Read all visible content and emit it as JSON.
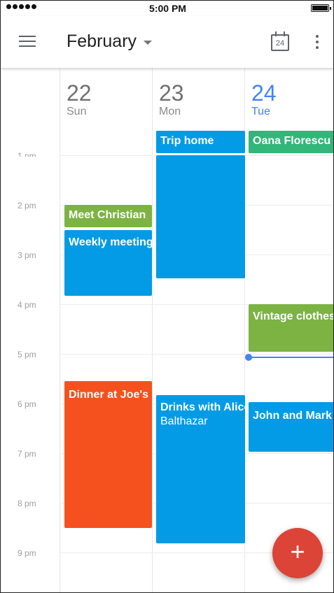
{
  "status_bar": {
    "time": "5:00 PM"
  },
  "app_bar": {
    "month": "February",
    "today_number": "24"
  },
  "days": [
    {
      "number": "22",
      "weekday": "Sun"
    },
    {
      "number": "23",
      "weekday": "Mon"
    },
    {
      "number": "24",
      "weekday": "Tue"
    }
  ],
  "hours": [
    "1 pm",
    "2 pm",
    "3 pm",
    "4 pm",
    "5 pm",
    "6 pm",
    "7 pm",
    "8 pm",
    "9 pm"
  ],
  "events": {
    "meet_christian": "Meet Christian",
    "weekly_meeting": "Weekly meeting",
    "dinner_joes": "Dinner at Joe's",
    "trip_home": "Trip home",
    "drinks": "Drinks with Alice",
    "drinks_location": "Balthazar",
    "oana": "Oana Florescu",
    "vintage": "Vintage clothes",
    "john_mark": "John and Mark"
  },
  "colors": {
    "blue": "#039be5",
    "green": "#7cb342",
    "teal": "#33b679",
    "orange": "#f4511e",
    "today_accent": "#4285f4",
    "fab_red": "#db4437"
  },
  "fab": {
    "label": "+"
  }
}
